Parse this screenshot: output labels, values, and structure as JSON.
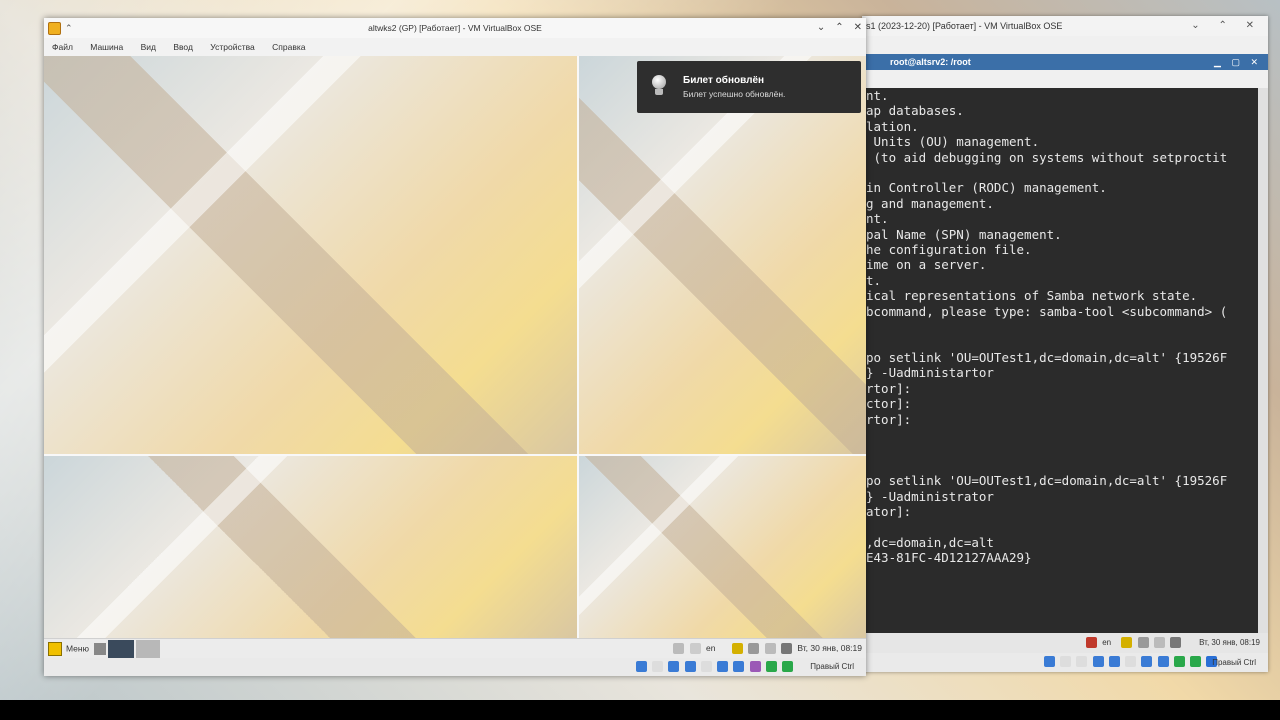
{
  "main_vm": {
    "title": "altwks2 (GP) [Работает] - VM VirtualBox OSE",
    "menu": [
      "Файл",
      "Машина",
      "Вид",
      "Ввод",
      "Устройства",
      "Справка"
    ],
    "notification": {
      "title": "Билет обновлён",
      "body": "Билет успешно обновлён.",
      "icon": "lightbulb-icon"
    },
    "guest_panel": {
      "menu_label": "Меню",
      "lang": "en",
      "clock": "Вт, 30 янв, 08:19"
    },
    "host_key": "Правый Ctrl"
  },
  "bg_vm": {
    "title": "s1 (2023-12-20) [Работает] - VM VirtualBox OSE",
    "terminal_title": "root@altsrv2: /root",
    "terminal_lines": [
      "nt.",
      "ap databases.",
      "lation.",
      " Units (OU) management.",
      " (to aid debugging on systems without setproctit",
      "",
      "in Controller (RODC) management.",
      "g and management.",
      "nt.",
      "pal Name (SPN) management.",
      "he configuration file.",
      "ime on a server.",
      "t.",
      "ical representations of Samba network state.",
      "bcommand, please type: samba-tool <subcommand> (",
      "",
      "",
      "po setlink 'OU=OUTest1,dc=domain,dc=alt' {19526F",
      "} -Uadministartor",
      "rtor]:",
      "ctor]:",
      "rtor]:",
      "",
      "",
      "",
      "po setlink 'OU=OUTest1,dc=domain,dc=alt' {19526F",
      "} -Uadministrator",
      "ator]:",
      "",
      ",dc=domain,dc=alt",
      "E43-81FC-4D12127AAA29}"
    ],
    "tray": {
      "lang": "en",
      "clock": "Вт, 30 янв, 08:19"
    },
    "host_key": "Правый Ctrl"
  }
}
